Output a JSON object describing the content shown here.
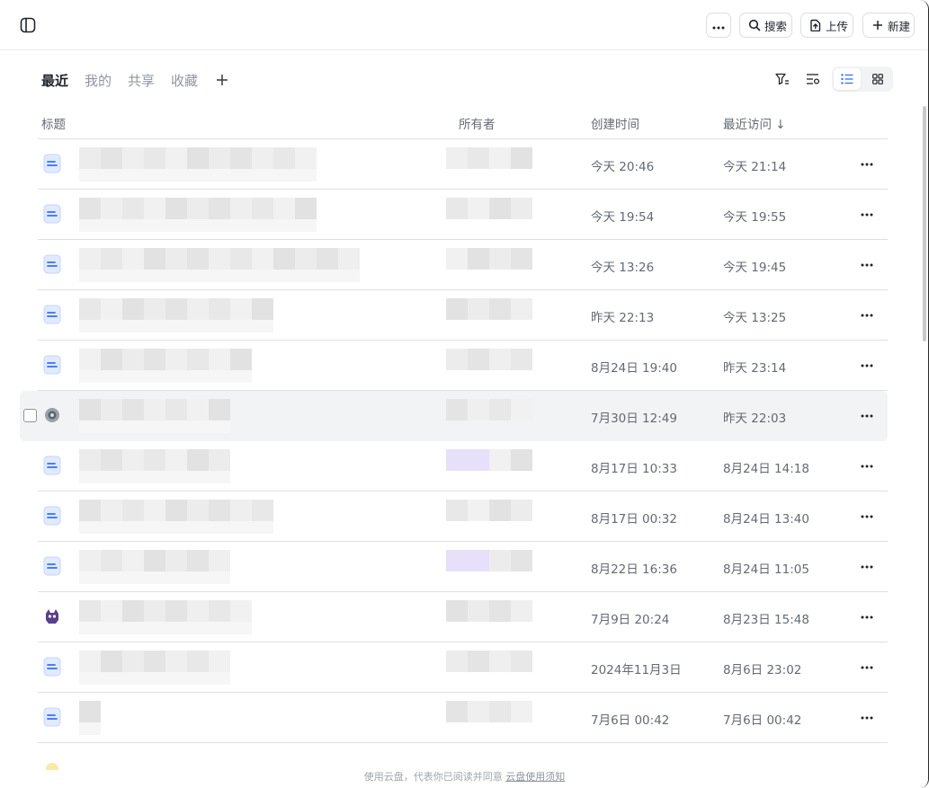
{
  "header": {
    "search_label": "搜索",
    "upload_label": "上传",
    "new_label": "新建"
  },
  "tabs": [
    {
      "label": "最近",
      "active": true
    },
    {
      "label": "我的"
    },
    {
      "label": "共享"
    },
    {
      "label": "收藏"
    }
  ],
  "table": {
    "columns": {
      "title": "标题",
      "owner": "所有者",
      "created": "创建时间",
      "accessed": "最近访问 ↓"
    },
    "rows": [
      {
        "icon": "doc-icon",
        "created": "今天 20:46",
        "accessed": "今天 21:14"
      },
      {
        "icon": "doc-icon",
        "created": "今天 19:54",
        "accessed": "今天 19:55"
      },
      {
        "icon": "doc-icon",
        "created": "今天 13:26",
        "accessed": "今天 19:45"
      },
      {
        "icon": "doc-icon",
        "created": "昨天 22:13",
        "accessed": "今天 13:25"
      },
      {
        "icon": "doc-icon",
        "created": "8月24日 19:40",
        "accessed": "昨天 23:14"
      },
      {
        "icon": "gear-app-icon",
        "created": "7月30日 12:49",
        "accessed": "昨天 22:03",
        "hover": true
      },
      {
        "icon": "doc-icon",
        "created": "8月17日 10:33",
        "accessed": "8月24日 14:18"
      },
      {
        "icon": "doc-icon",
        "created": "8月17日 00:32",
        "accessed": "8月24日 13:40"
      },
      {
        "icon": "doc-icon",
        "created": "8月22日 16:36",
        "accessed": "8月24日 11:05"
      },
      {
        "icon": "monster-app-icon",
        "created": "7月9日 20:24",
        "accessed": "8月23日 15:48"
      },
      {
        "icon": "doc-icon",
        "created": "2024年11月3日",
        "accessed": "8月6日 23:02"
      },
      {
        "icon": "doc-icon",
        "created": "7月6日 00:42",
        "accessed": "7月6日 00:42"
      }
    ]
  },
  "footer": {
    "text": "使用云盘，代表你已阅读并同意",
    "link": "云盘使用须知"
  },
  "colors": {
    "accent": "#3370ff",
    "doc_icon_bg": "#e1eaff",
    "row_hover": "#f2f3f5"
  }
}
